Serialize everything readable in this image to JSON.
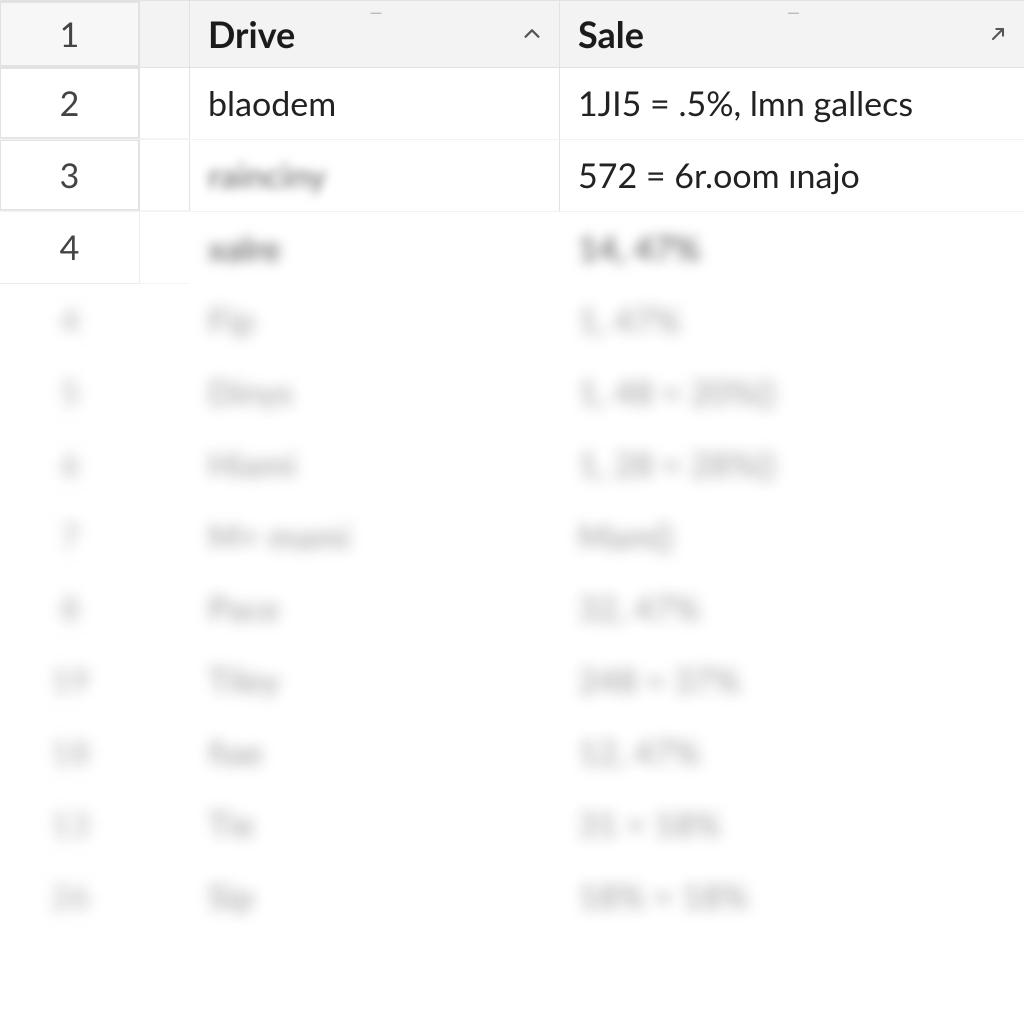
{
  "header": {
    "rownum": "1",
    "col1": "Drive",
    "col2": "Sale"
  },
  "rows": [
    {
      "num": "2",
      "drive": "blaodem",
      "sale": "1JI5 = .5%, lmn gallecs"
    },
    {
      "num": "3",
      "drive": "rainciny",
      "sale": "572 = 6r.oom ınajo"
    },
    {
      "num": "4",
      "drive": "xalre",
      "sale": "14, 47%"
    }
  ],
  "blurred_rows": [
    {
      "num": "4",
      "drive": "Fip",
      "sale": "1, 47%"
    },
    {
      "num": "5",
      "drive": "Dinys",
      "sale": "1, 48 = 20%()"
    },
    {
      "num": "6",
      "drive": "Hiami",
      "sale": "1, 28 = 28%()"
    },
    {
      "num": "7",
      "drive": "M+ mami",
      "sale": "Mam()"
    },
    {
      "num": "8",
      "drive": "Pace",
      "sale": "32, 47%"
    },
    {
      "num": "19",
      "drive": "Tiley",
      "sale": "248 = 37%"
    },
    {
      "num": "18",
      "drive": "fiae",
      "sale": "12, 47%"
    },
    {
      "num": "13",
      "drive": "Tie",
      "sale": "31 = 18%"
    },
    {
      "num": "26",
      "drive": "Sip",
      "sale": "18% = 18%"
    }
  ]
}
